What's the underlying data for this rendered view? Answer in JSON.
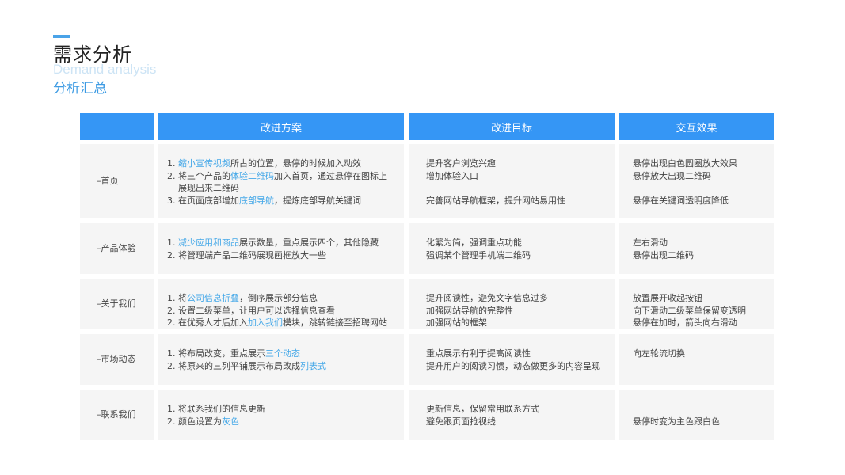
{
  "header": {
    "title": "需求分析",
    "title_en": "Demand analysis",
    "subtitle": "分析汇总"
  },
  "table": {
    "columns": [
      "",
      "改进方案",
      "改进目标",
      "交互效果"
    ],
    "rows": [
      {
        "label": "–首页",
        "plan": [
          {
            "num": "1. ",
            "pre": "",
            "hl": "缩小宣传视频",
            "post": "所占的位置，悬停的时候加入动效"
          },
          {
            "num": "2. ",
            "pre": "将三个产品的",
            "hl": "体验二维码",
            "post": "加入首页，通过悬停在图标上"
          },
          {
            "num": "",
            "pre": "展现出来二维码",
            "hl": "",
            "post": ""
          },
          {
            "num": "3. ",
            "pre": "在页面底部增加",
            "hl": "底部导航",
            "post": "，提炼底部导航关键词"
          }
        ],
        "goal": [
          "提升客户浏览兴趣",
          "增加体验入口",
          "",
          "完善网站导航框架，提升网站易用性"
        ],
        "effect": [
          "悬停出现白色圆圈放大效果",
          "悬停放大出现二维码",
          "",
          "悬停在关键词透明度降低"
        ],
        "height": 94
      },
      {
        "label": "–产品体验",
        "plan": [
          {
            "num": "1. ",
            "pre": "",
            "hl": "减少应用和商品",
            "post": "展示数量，重点展示四个，其他隐藏"
          },
          {
            "num": "2. ",
            "pre": "将管理端产品二维码展现画框放大一些",
            "hl": "",
            "post": ""
          }
        ],
        "goal": [
          "化繁为简，强调重点功能",
          "强调某个管理手机端二维码"
        ],
        "effect": [
          "左右滑动",
          "悬停出现二维码"
        ],
        "height": 64
      },
      {
        "label": "–关于我们",
        "plan": [
          {
            "num": "1. ",
            "pre": "将",
            "hl": "公司信息折叠",
            "post": "，倒序展示部分信息"
          },
          {
            "num": "2. ",
            "pre": "设置二级菜单，让用户可以选择信息查看",
            "hl": "",
            "post": ""
          },
          {
            "num": "2. ",
            "pre": "在优秀人才后加入",
            "hl": "加入我们",
            "post": "模块，跳转链接至招聘网站"
          }
        ],
        "goal": [
          "提升阅读性，避免文字信息过多",
          "加强网站导航的完整性",
          "加强网站的框架"
        ],
        "effect": [
          "放置展开收起按钮",
          "向下滑动二级菜单保留变透明",
          "悬停在加时，箭头向右滑动"
        ],
        "height": 64
      },
      {
        "label": "–市场动态",
        "plan": [
          {
            "num": "1. ",
            "pre": "将布局改变，重点展示",
            "hl": "三个动态",
            "post": ""
          },
          {
            "num": "2. ",
            "pre": "将原来的三列平铺展示布局改成",
            "hl": "列表式",
            "post": ""
          }
        ],
        "goal": [
          "重点展示有利于提高阅读性",
          "提升用户的阅读习惯，动态做更多的内容呈现"
        ],
        "effect": [
          "向左轮流切换"
        ],
        "height": 64
      },
      {
        "label": "–联系我们",
        "plan": [
          {
            "num": "1. ",
            "pre": "将联系我们的信息更新",
            "hl": "",
            "post": ""
          },
          {
            "num": "2. ",
            "pre": "颜色设置为",
            "hl": "灰色",
            "post": ""
          }
        ],
        "goal": [
          "更新信息，保留常用联系方式",
          "避免跟页面抢视线"
        ],
        "effect": [
          "",
          "悬停时变为主色跟白色"
        ],
        "height": 64
      }
    ]
  },
  "colors": {
    "accent": "#3596f5",
    "highlight": "#45a8e8",
    "cell_bg": "#f5f5f5"
  }
}
